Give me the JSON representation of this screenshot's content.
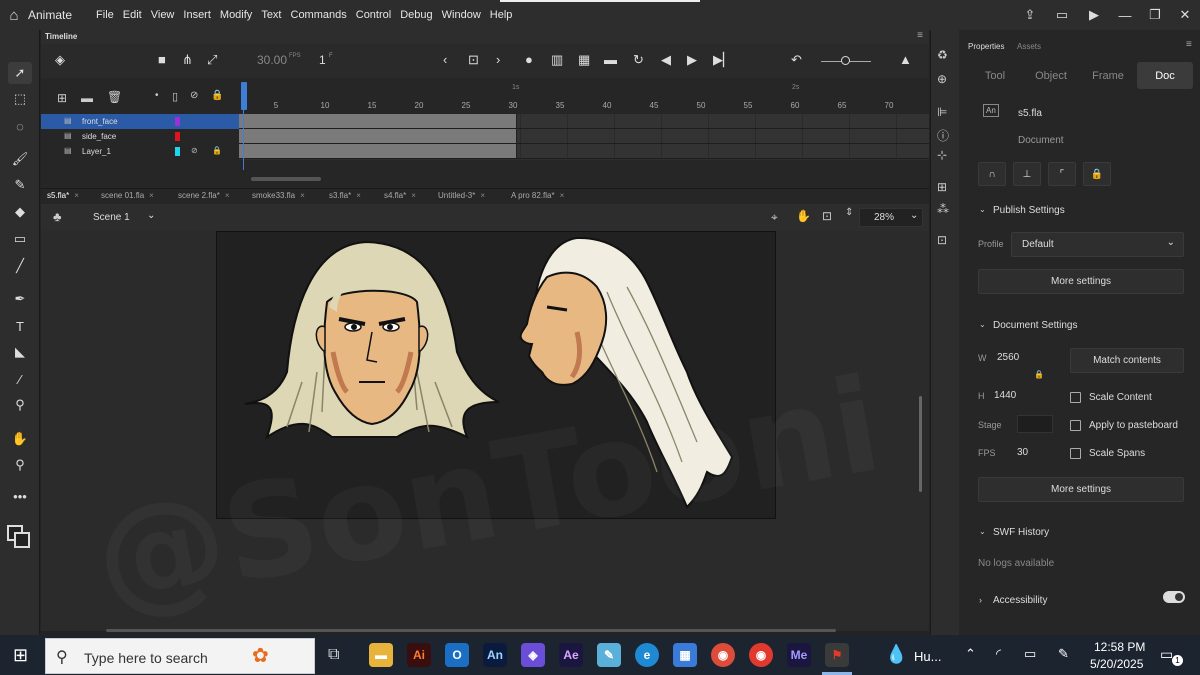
{
  "app": {
    "name": "Animate"
  },
  "menu": [
    "File",
    "Edit",
    "View",
    "Insert",
    "Modify",
    "Text",
    "Commands",
    "Control",
    "Debug",
    "Window",
    "Help"
  ],
  "timeline": {
    "tab": "Timeline",
    "fps_value": "30.00",
    "fps_unit": "FPS",
    "frame_value": "1",
    "frame_unit": "F",
    "layers": [
      {
        "name": "front_face",
        "color": "#9b30d9",
        "selected": true
      },
      {
        "name": "side_face",
        "color": "#e0141e",
        "selected": false
      },
      {
        "name": "Layer_1",
        "color": "#1fd5e8",
        "selected": false
      }
    ],
    "ruler_numbers": [
      "5",
      "10",
      "15",
      "20",
      "25",
      "30",
      "35",
      "40",
      "45",
      "50",
      "55",
      "60",
      "65",
      "70"
    ],
    "seconds": [
      "1s",
      "2s"
    ]
  },
  "doc_tabs": [
    "s5.fla*",
    "scene 01.fla",
    "scene 2.fla*",
    "smoke33.fla",
    "s3.fla*",
    "s4.fla*",
    "Untitled-3*",
    "A pro 82.fla*"
  ],
  "scene": {
    "name": "Scene 1",
    "zoom": "28%"
  },
  "watermark": "@SonTooni",
  "properties": {
    "tabs": [
      "Properties",
      "Assets"
    ],
    "segments": [
      "Tool",
      "Object",
      "Frame",
      "Doc"
    ],
    "doc_file": "s5.fla",
    "doc_label": "Document",
    "publish_settings": "Publish Settings",
    "profile_label": "Profile",
    "profile_value": "Default",
    "more_settings": "More settings",
    "document_settings": "Document Settings",
    "w_label": "W",
    "w_value": "2560",
    "h_label": "H",
    "h_value": "1440",
    "match_contents": "Match contents",
    "scale_content": "Scale Content",
    "stage_label": "Stage",
    "apply_pasteboard": "Apply to pasteboard",
    "fps_label": "FPS",
    "fps_value": "30",
    "scale_spans": "Scale Spans",
    "swf_history": "SWF History",
    "no_logs": "No logs available",
    "accessibility": "Accessibility"
  },
  "taskbar": {
    "search_placeholder": "Type here to search",
    "weather": "Hu...",
    "time": "12:58 PM",
    "date": "5/20/2025",
    "notif": "1"
  }
}
